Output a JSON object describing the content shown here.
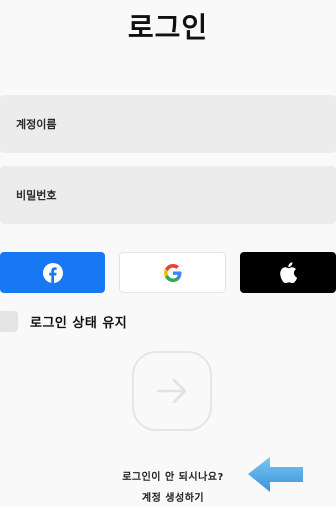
{
  "header": {
    "title": "로그인"
  },
  "form": {
    "username_placeholder": "계정이름",
    "username_value": "",
    "password_placeholder": "비밀번호",
    "password_value": ""
  },
  "social": {
    "facebook_icon": "facebook-icon",
    "google_icon": "google-icon",
    "apple_icon": "apple-icon",
    "facebook_color": "#1877f2",
    "apple_color": "#000000"
  },
  "remember": {
    "label": "로그인 상태 유지",
    "checked": false
  },
  "submit": {
    "icon": "arrow-right-icon"
  },
  "footer": {
    "forgot_label": "로그인이 안 되시나요?",
    "create_label": "계정 생성하기"
  },
  "overlay": {
    "pointer_icon": "arrow-left-icon",
    "pointer_color": "#4aa6e8"
  }
}
